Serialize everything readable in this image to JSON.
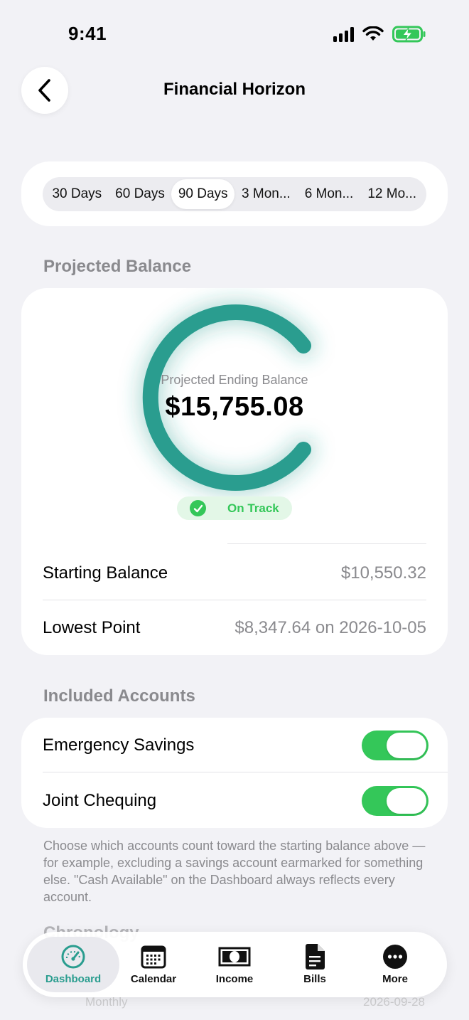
{
  "status": {
    "time": "9:41"
  },
  "nav": {
    "title": "Financial Horizon"
  },
  "horizon": {
    "options": [
      "30 Days",
      "60 Days",
      "90 Days",
      "3 Mon...",
      "6 Mon...",
      "12 Mo..."
    ],
    "selected": "90 Days"
  },
  "projected": {
    "section_label": "Projected Balance",
    "gauge_label": "Projected Ending Balance",
    "gauge_value": "$15,755.08",
    "status": "On Track",
    "rows": [
      {
        "label": "Starting Balance",
        "value": "$10,550.32"
      },
      {
        "label": "Lowest Point",
        "value": "$8,347.64 on 2026-10-05"
      }
    ]
  },
  "accounts": {
    "section_label": "Included Accounts",
    "items": [
      {
        "name": "Emergency Savings",
        "enabled": true
      },
      {
        "name": "Joint Chequing",
        "enabled": true
      }
    ],
    "footnote": "Choose which accounts count toward the starting balance above — for example, excluding a savings account earmarked for something else. \"Cash Available\" on the Dashboard always reflects every account."
  },
  "chronology": {
    "section_label": "Chronology",
    "peek_left": "Monthly",
    "peek_right": "2026-09-28"
  },
  "tabs": [
    {
      "label": "Dashboard",
      "icon": "gauge-icon",
      "active": true
    },
    {
      "label": "Calendar",
      "icon": "calendar-icon",
      "active": false
    },
    {
      "label": "Income",
      "icon": "banknote-icon",
      "active": false
    },
    {
      "label": "Bills",
      "icon": "document-icon",
      "active": false
    },
    {
      "label": "More",
      "icon": "ellipsis-icon",
      "active": false
    }
  ],
  "colors": {
    "accent": "#2a9d8f",
    "success": "#34c759",
    "background": "#f2f2f6"
  }
}
